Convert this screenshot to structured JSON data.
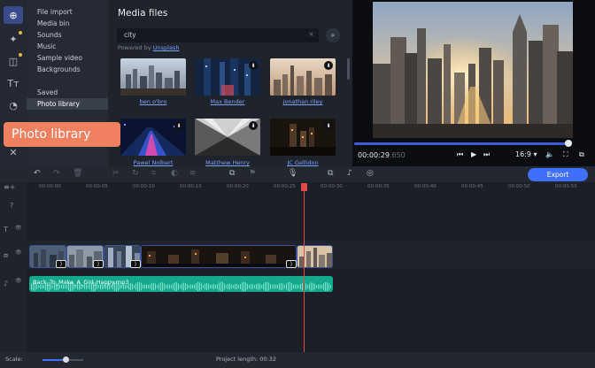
{
  "rail": {
    "tools": [
      {
        "name": "import-icon",
        "glyph": "⊕"
      },
      {
        "name": "magic-wand-icon",
        "glyph": "✦"
      },
      {
        "name": "transitions-icon",
        "glyph": "◫"
      },
      {
        "name": "titles-icon",
        "glyph": "Tт"
      },
      {
        "name": "stickers-icon",
        "glyph": "◔"
      },
      {
        "name": "tools-icon",
        "glyph": "✕"
      }
    ]
  },
  "categories": {
    "items": [
      "File import",
      "Media bin",
      "Sounds",
      "Music",
      "Sample video",
      "Backgrounds"
    ],
    "saved": "Saved",
    "photo_library": "Photo library"
  },
  "media": {
    "title": "Media files",
    "search_value": "city",
    "search_clear": "×",
    "search_icon": "⌕",
    "powered_by": "Powered by",
    "powered_link": "Unsplash",
    "download_icon": "⬇",
    "authors": [
      "ben o'bro",
      "Max Bender",
      "jonathan riley",
      "Pawel Nolbert",
      "Matthew Henry",
      "JC Gellidon"
    ]
  },
  "callout": {
    "text": "Photo library"
  },
  "preview": {
    "time_main": "00:00:29",
    "time_frac": ".650",
    "aspect": "16:9 ▾",
    "progress": 0.99,
    "buttons": {
      "prev": "⏮",
      "play": "▶",
      "next": "⏭",
      "volume": "🔈",
      "fullscreen": "⛶",
      "popout": "⧉"
    }
  },
  "toolbar": {
    "export_label": "Export",
    "icons": {
      "undo": "↶",
      "redo": "↷",
      "delete": "🗑",
      "cut": "✂",
      "rotate": "↻",
      "crop": "⌗",
      "color": "◐",
      "speed": "⚙",
      "adjust": "≡",
      "monitor": "⧉",
      "flag": "⚑",
      "mic": "🎙",
      "record": "◉",
      "webcam": "◎",
      "audio": "♪"
    }
  },
  "timeline": {
    "ticks": [
      "00:00:00",
      "00:00:05",
      "00:00:10",
      "00:00:15",
      "00:00:20",
      "00:00:25",
      "00:00:30",
      "00:00:35",
      "00:00:40",
      "00:00:45",
      "00:00:50",
      "00:00:55"
    ],
    "audio_clip_name": "Back_To_Make_A_Girl_Happy.mp3",
    "head_icons": {
      "add": "≡+",
      "help": "?",
      "text": "T",
      "eye": "👁",
      "video": "⧈",
      "music": "♪"
    },
    "transition_glyph": "⟩"
  },
  "status": {
    "scale_label": "Scale:",
    "scale_value": 0.5,
    "project_length": "Project length:  00:32"
  }
}
